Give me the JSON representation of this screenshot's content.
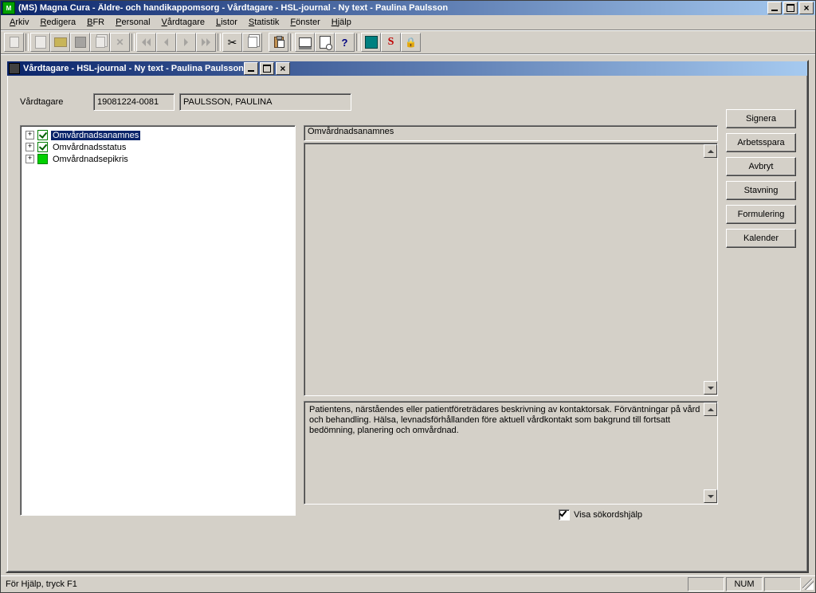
{
  "window": {
    "title": "(MS) Magna Cura - Äldre- och handikappomsorg - Vårdtagare - HSL-journal - Ny text - Paulina Paulsson"
  },
  "menu": {
    "arkiv": "Arkiv",
    "redigera": "Redigera",
    "bfr": "BFR",
    "personal": "Personal",
    "vardtagare": "Vårdtagare",
    "listor": "Listor",
    "statistik": "Statistik",
    "fonster": "Fönster",
    "hjalp": "Hjälp"
  },
  "child_window": {
    "title": "Vårdtagare - HSL-journal - Ny text - Paulina Paulsson"
  },
  "patient": {
    "label": "Vårdtagare",
    "pnr": "19081224-0081",
    "name": "PAULSSON, PAULINA"
  },
  "tree": {
    "items": [
      {
        "label": "Omvårdnadsanamnes",
        "selected": true,
        "checked": true
      },
      {
        "label": "Omvårdnadsstatus",
        "selected": false,
        "checked": true
      },
      {
        "label": "Omvårdnadsepikris",
        "selected": false,
        "checked": false,
        "green": true
      }
    ]
  },
  "editor": {
    "heading": "Omvårdnadsanamnes",
    "help_text": "Patientens, närståendes eller patientföreträdares beskrivning av kontaktorsak. Förväntningar på vård och behandling. Hälsa, levnadsförhållanden före aktuell vårdkontakt som bakgrund till fortsatt bedömning, planering och omvårdnad."
  },
  "buttons": {
    "signera": "Signera",
    "arbetsspara": "Arbetsspara",
    "avbryt": "Avbryt",
    "stavning": "Stavning",
    "formulering": "Formulering",
    "kalender": "Kalender"
  },
  "checkbox": {
    "visa_sokord": "Visa sökordshjälp",
    "checked": true
  },
  "statusbar": {
    "help": "För Hjälp, tryck F1",
    "num": "NUM"
  }
}
